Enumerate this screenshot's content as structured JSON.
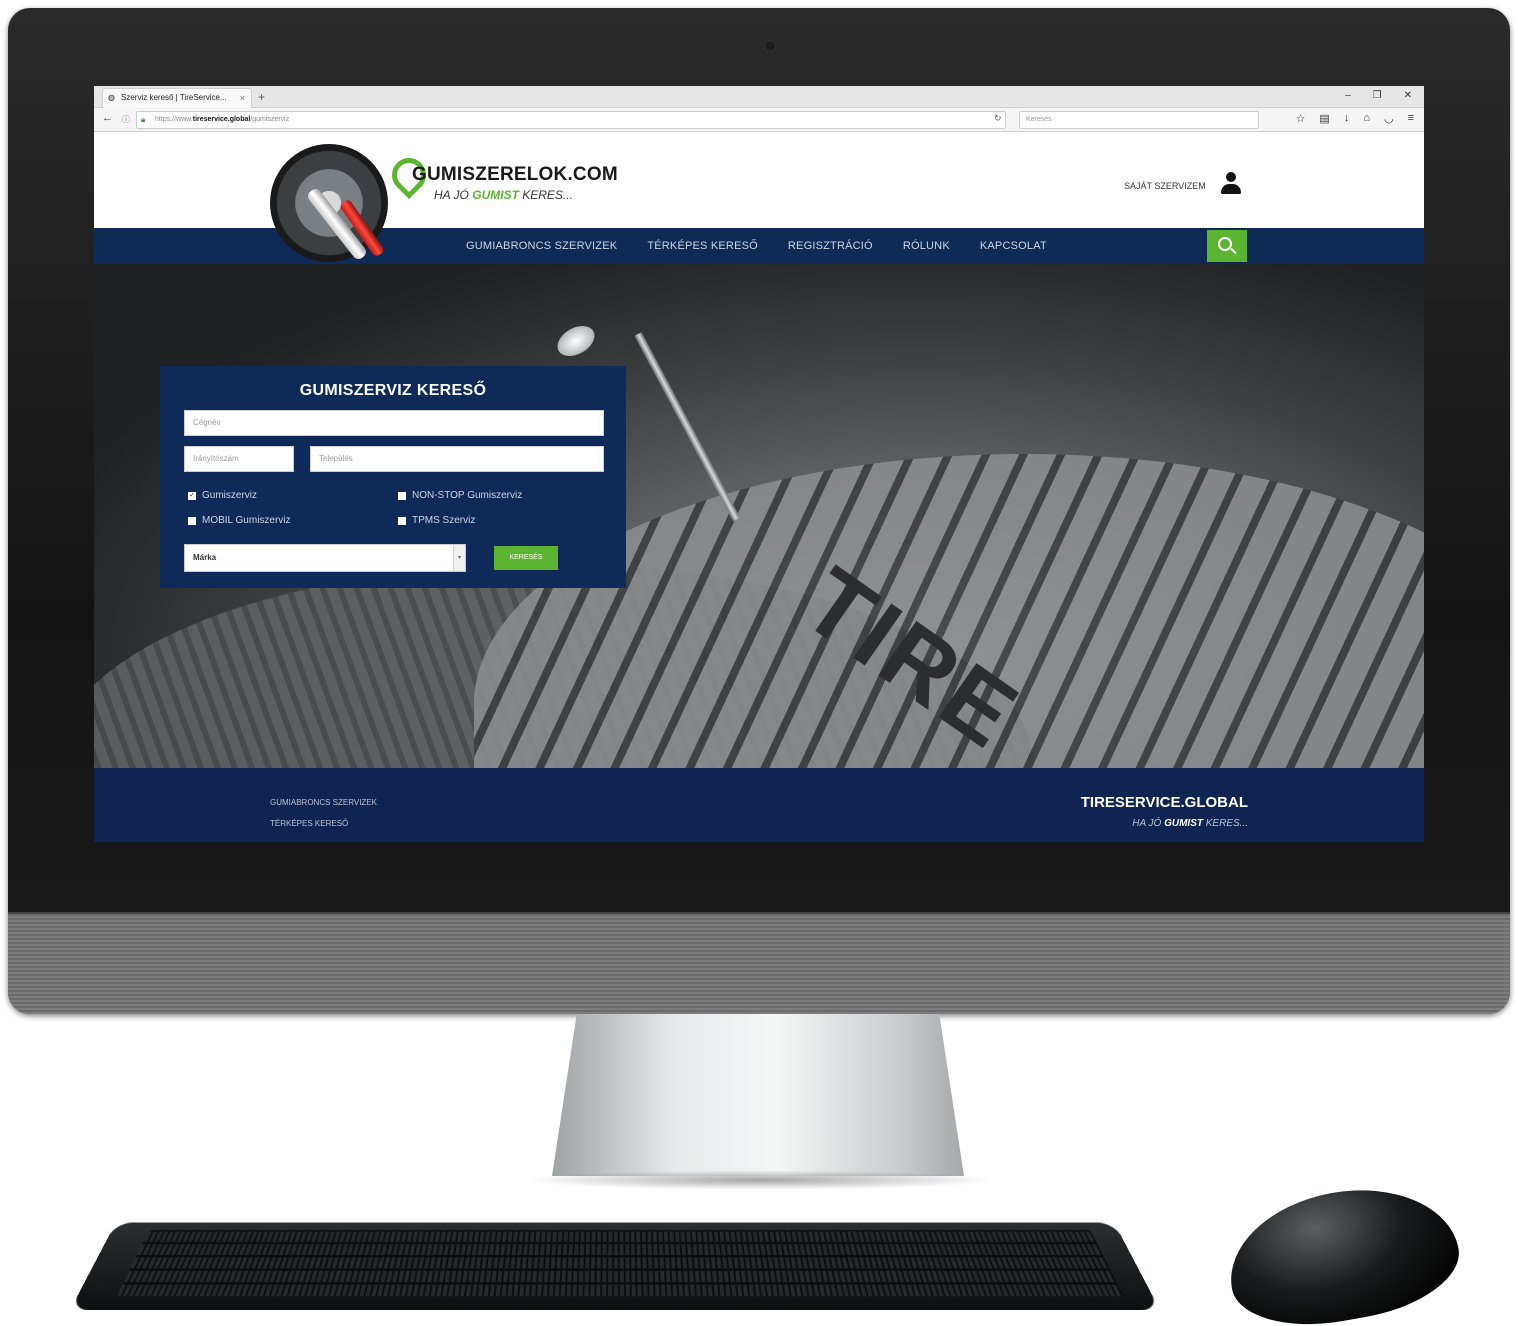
{
  "browser": {
    "tab_title": "Szerviz kereső | TireService...",
    "tab_close": "×",
    "new_tab": "+",
    "window_controls": [
      "–",
      "❐",
      "✕"
    ],
    "url_prefix": "https://www.",
    "url_domain": "tireservice.global",
    "url_path": "/gumiszerviz",
    "search_placeholder": "Keresés"
  },
  "header": {
    "logo_title": "GUMISZERELOK.COM",
    "logo_tagline_pre": "HA JÓ ",
    "logo_tagline_highlight": "GUMIST",
    "logo_tagline_post": " KERES...",
    "own_service_label": "SAJÁT SZERVIZEM"
  },
  "nav": {
    "items": [
      {
        "label": "GUMIABRONCS SZERVIZEK"
      },
      {
        "label": "TÉRKÉPES KERESŐ"
      },
      {
        "label": "REGISZTRÁCIÓ"
      },
      {
        "label": "RÓLUNK"
      },
      {
        "label": "KAPCSOLAT"
      }
    ]
  },
  "hero": {
    "tire_text": "TIRE"
  },
  "search_panel": {
    "title": "GUMISZERVIZ KERESŐ",
    "company_placeholder": "Cégnév",
    "zip_placeholder": "Irányítószám",
    "city_placeholder": "Település",
    "checkboxes": [
      {
        "label": "Gumiszerviz",
        "checked": true
      },
      {
        "label": "NON-STOP Gumiszerviz",
        "checked": false
      },
      {
        "label": "MOBIL Gumiszerviz",
        "checked": false
      },
      {
        "label": "TPMS Szerviz",
        "checked": false
      }
    ],
    "brand_select_value": "Márka",
    "submit_label": "KERESÉS"
  },
  "footer": {
    "links": [
      {
        "label": "GUMIABRONCS SZERVIZEK"
      },
      {
        "label": "TÉRKÉPES KERESŐ"
      }
    ],
    "brand": "TIRESERVICE.GLOBAL",
    "tagline_pre": "HA JÓ ",
    "tagline_highlight": "GUMIST",
    "tagline_post": " KERES..."
  },
  "colors": {
    "navy": "#102a56",
    "green": "#5cb531"
  }
}
